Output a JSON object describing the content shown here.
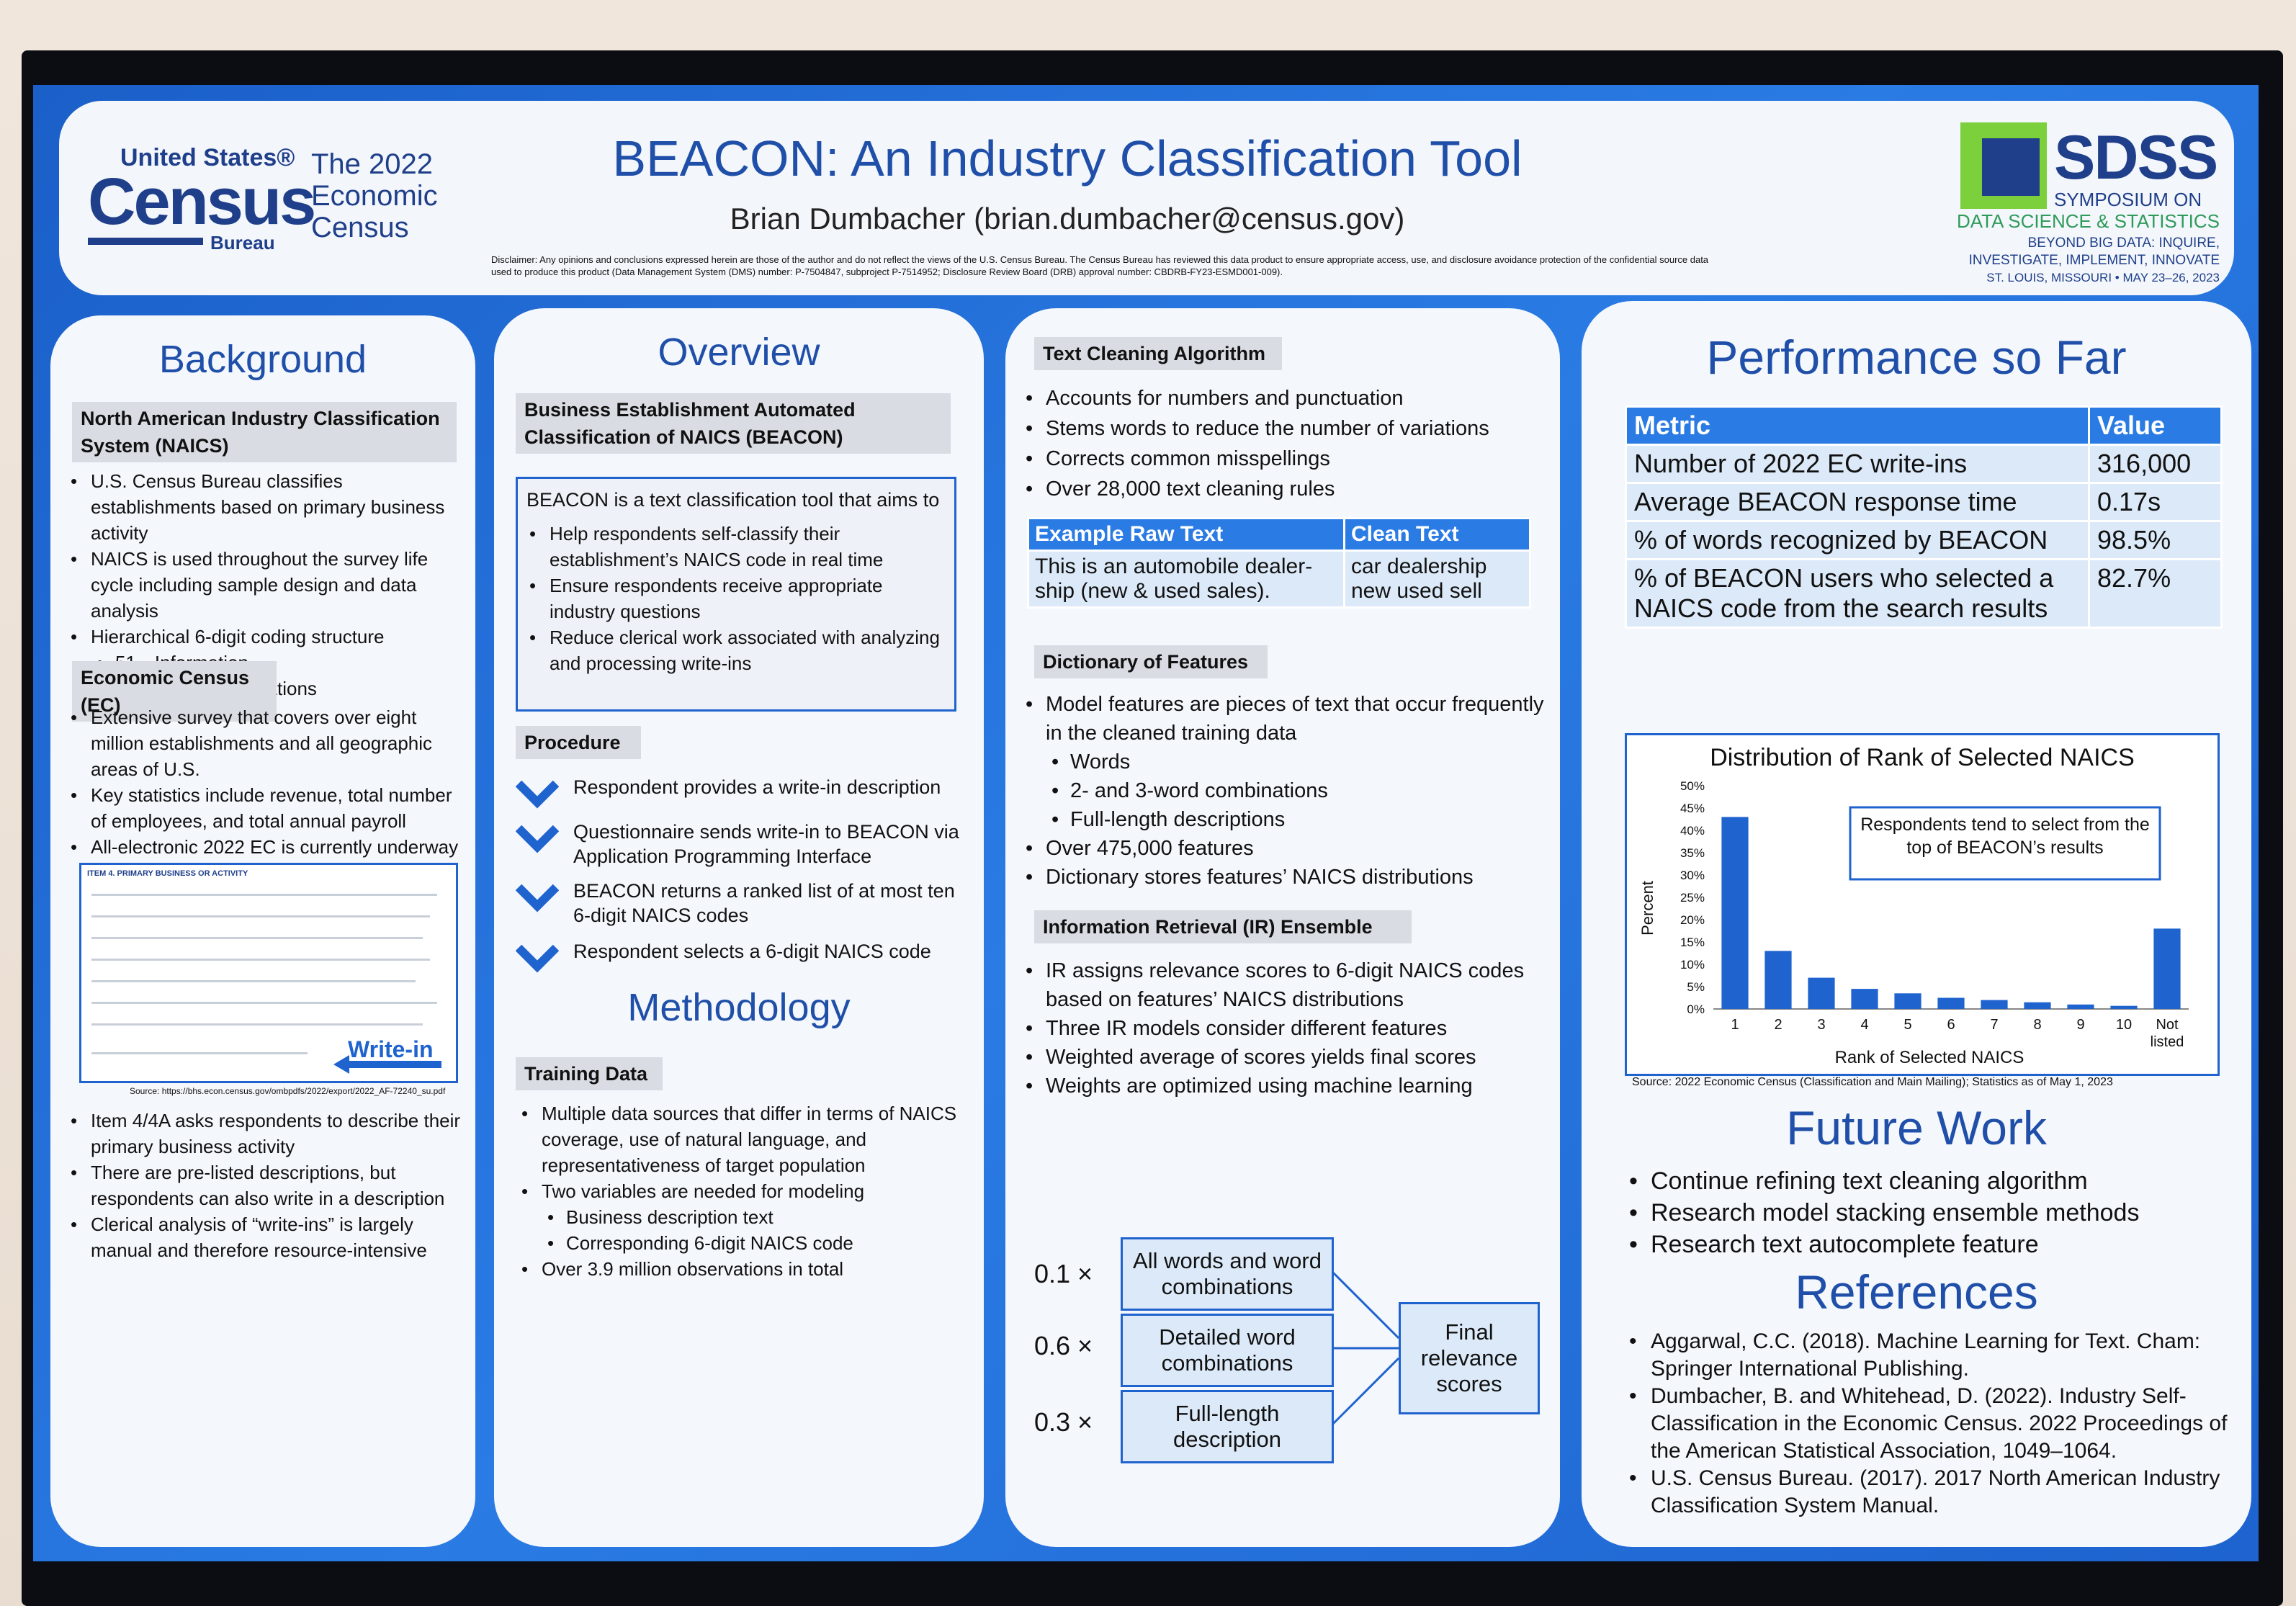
{
  "header": {
    "census_us": "United States®",
    "census_word": "Census",
    "census_bureau": "Bureau",
    "econ_census": "The 2022 Economic Census",
    "title": "BEACON: An Industry Classification Tool",
    "author": "Brian Dumbacher (brian.dumbacher@census.gov)",
    "disclaimer": "Disclaimer: Any opinions and conclusions expressed herein are those of the author and do not reflect the views of the U.S. Census Bureau. The Census Bureau has reviewed this data product to ensure appropriate access, use, and disclosure avoidance protection of the confidential source data used to produce this product (Data Management System (DMS) number: P-7504847, subproject P-7514952; Disclosure Review Board (DRB) approval number: CBDRB-FY23-ESMD001-009).",
    "sdss_word": "SDSS",
    "sdss_sub": "SYMPOSIUM ON",
    "sdss_sub2": "DATA SCIENCE & STATISTICS",
    "sdss_sub3": "BEYOND BIG DATA: INQUIRE, INVESTIGATE, IMPLEMENT, INNOVATE",
    "sdss_sub4": "ST. LOUIS, MISSOURI • MAY 23–26, 2023"
  },
  "background": {
    "title": "Background",
    "naics_head": "North American Industry Classification System (NAICS)",
    "naics_items": [
      "U.S. Census Bureau classifies establishments based on primary business activity",
      "NAICS is used throughout the survey life cycle including sample design and data analysis",
      "Hierarchical 6-digit coding structure"
    ],
    "naics_sub": [
      "51—Information",
      "515112—Radio Stations"
    ],
    "ec_head": "Economic Census (EC)",
    "ec_items": [
      "Extensive survey that covers over eight million establishments and all geographic areas of U.S.",
      "Key statistics include revenue, total number of employees, and total annual payroll",
      "All-electronic 2022 EC is currently underway"
    ],
    "survey_title": "ITEM 4. PRIMARY BUSINESS OR ACTIVITY",
    "write_in": "Write-in",
    "source": "Source: https://bhs.econ.census.gov/ombpdfs/2022/export/2022_AF-72240_su.pdf",
    "after_items": [
      "Item 4/4A asks respondents to describe their primary business activity",
      "There are pre-listed descriptions, but respondents can also write in a description",
      "Clerical analysis of “write-ins” is largely manual and therefore resource-intensive"
    ]
  },
  "overview": {
    "title": "Overview",
    "beacon_head": "Business Establishment Automated Classification of NAICS (BEACON)",
    "box_intro": "BEACON is a text classification tool that aims to",
    "box_items": [
      "Help respondents self-classify their establishment’s NAICS code in real time",
      "Ensure respondents receive appropriate industry questions",
      "Reduce clerical work associated with analyzing and processing write-ins"
    ],
    "procedure_head": "Procedure",
    "steps": [
      "Respondent provides a write-in description",
      "Questionnaire sends write-in to BEACON via Application Programming Interface",
      "BEACON returns a ranked list of at most ten 6-digit NAICS codes",
      "Respondent selects a 6-digit NAICS code"
    ],
    "methodology_title": "Methodology",
    "training_head": "Training Data",
    "training_items": [
      "Multiple data sources that differ in terms of NAICS coverage, use of natural language, and representativeness of target population",
      "Two variables are needed for modeling"
    ],
    "training_sub": [
      "Business description text",
      "Corresponding 6-digit NAICS code"
    ],
    "training_last": "Over 3.9 million observations in total"
  },
  "textclean": {
    "head": "Text Cleaning Algorithm",
    "items": [
      "Accounts for numbers and punctuation",
      "Stems words to reduce the number of variations",
      "Corrects common misspellings",
      "Over 28,000 text cleaning rules"
    ],
    "table_h1": "Example Raw Text",
    "table_h2": "Clean Text",
    "raw": "This is an automobile dealer-ship (new & used sales).",
    "clean": "car dealership new used sell",
    "dict_head": "Dictionary of Features",
    "dict_items": [
      "Model features are pieces of text that occur frequently in the cleaned training data"
    ],
    "dict_sub": [
      "Words",
      "2- and 3-word combinations",
      "Full-length descriptions"
    ],
    "dict_more": [
      "Over 475,000 features",
      "Dictionary stores features’ NAICS distributions"
    ],
    "ir_head": "Information Retrieval (IR) Ensemble",
    "ir_items": [
      "IR assigns relevance scores to 6-digit NAICS codes based on features’ NAICS distributions",
      "Three IR models consider different features",
      "Weighted average of scores yields final scores",
      "Weights are optimized using machine learning"
    ],
    "ens_w1": "0.1 ×",
    "ens_w2": "0.6 ×",
    "ens_w3": "0.3 ×",
    "ens_b1": "All words and word combinations",
    "ens_b2": "Detailed word combinations",
    "ens_b3": "Full-length description",
    "ens_final": "Final relevance scores"
  },
  "performance": {
    "title": "Performance so Far",
    "col_metric": "Metric",
    "col_value": "Value",
    "rows": [
      {
        "metric": "Number of 2022 EC write-ins",
        "value": "316,000"
      },
      {
        "metric": "Average BEACON response time",
        "value": "0.17s"
      },
      {
        "metric": "% of words recognized by BEACON",
        "value": "98.5%"
      },
      {
        "metric": "% of BEACON users who selected a NAICS code from the search results",
        "value": "82.7%"
      }
    ],
    "source": "Source: 2022 Economic Census (Classification and Main Mailing); Statistics as of May 1, 2023"
  },
  "chart_data": {
    "type": "bar",
    "title": "Distribution of Rank of Selected NAICS",
    "xlabel": "Rank of Selected NAICS",
    "ylabel": "Percent",
    "categories": [
      "1",
      "2",
      "3",
      "4",
      "5",
      "6",
      "7",
      "8",
      "9",
      "10",
      "Not listed"
    ],
    "values": [
      43,
      13,
      7,
      4.5,
      3.5,
      2.5,
      2,
      1.5,
      1,
      0.7,
      18
    ],
    "ylim": [
      0,
      50
    ],
    "yticks": [
      "0%",
      "5%",
      "10%",
      "15%",
      "20%",
      "25%",
      "30%",
      "35%",
      "40%",
      "45%",
      "50%"
    ],
    "annotation": "Respondents tend to select from the top of BEACON’s results",
    "grid": false,
    "colors": {
      "bar": "#1f63cf"
    }
  },
  "future": {
    "title": "Future Work",
    "items": [
      "Continue refining text cleaning algorithm",
      "Research model stacking ensemble methods",
      "Research text autocomplete feature"
    ]
  },
  "references": {
    "title": "References",
    "items": [
      "Aggarwal, C.C. (2018). Machine Learning for Text. Cham: Springer International Publishing.",
      "Dumbacher, B. and Whitehead, D. (2022). Industry Self-Classification in the Economic Census. 2022 Proceedings of the American Statistical Association, 1049–1064.",
      "U.S. Census Bureau. (2017). 2017 North American Industry Classification System Manual."
    ]
  },
  "colors": {
    "screen_blue": "#2a7be4",
    "title_blue": "#1f4fa8",
    "accent_green": "#7bd03c"
  }
}
